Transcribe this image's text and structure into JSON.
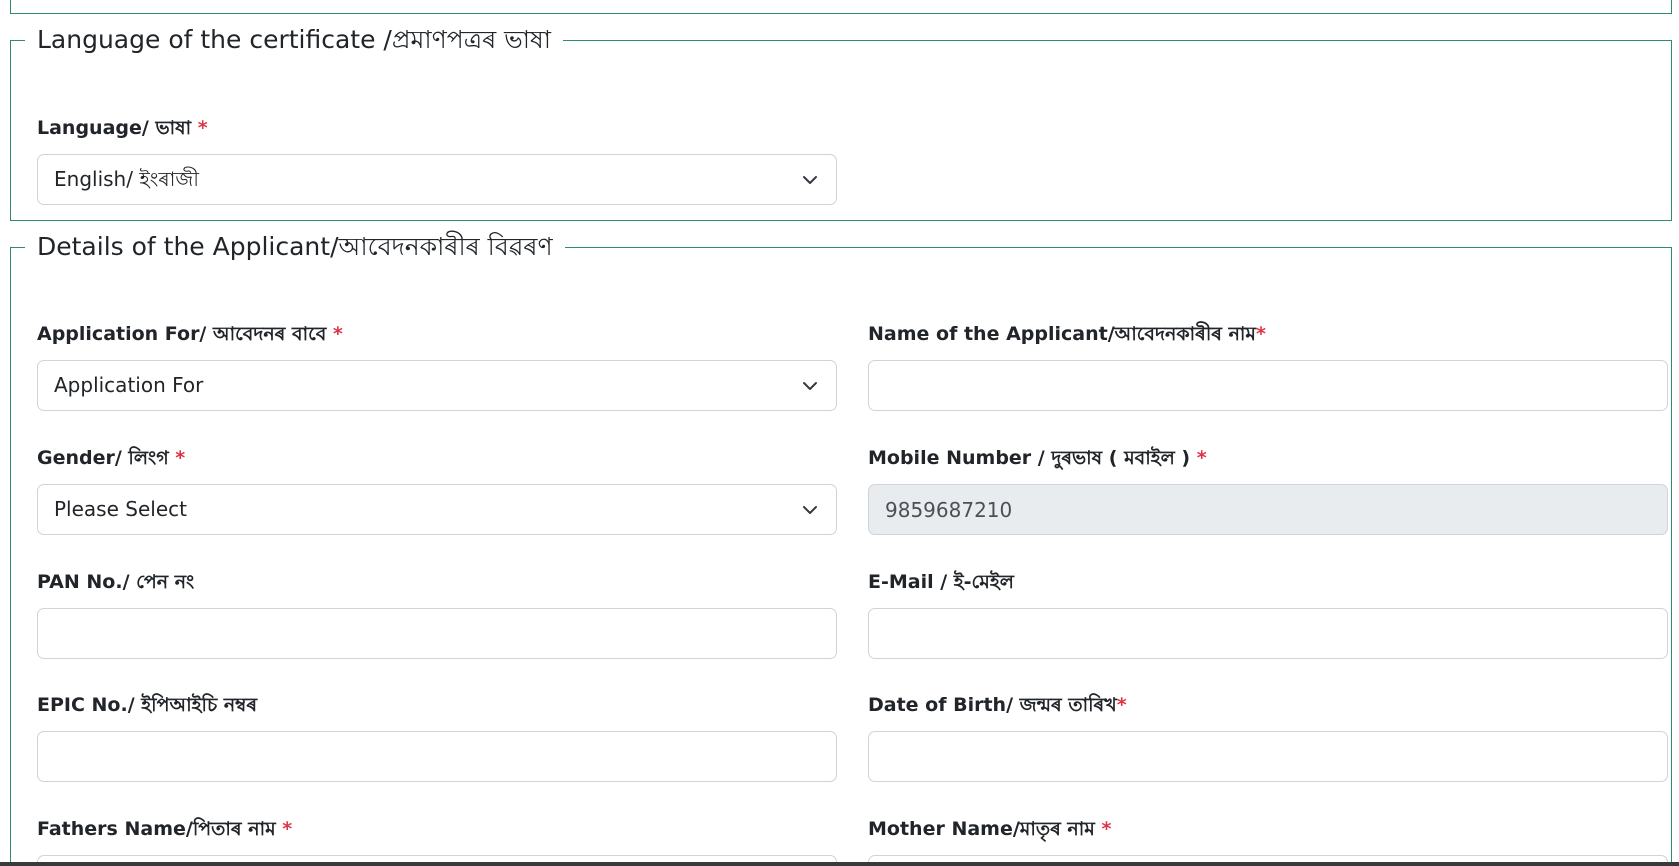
{
  "sections": {
    "language": {
      "legend": "Language of the certificate /প্ৰমাণপত্ৰৰ ভাষা",
      "fields": {
        "language": {
          "label": "Language/ ভাষা",
          "required": "*",
          "value": "English/ ইংৰাজী"
        }
      }
    },
    "details": {
      "legend": "Details of the Applicant/আবেদনকাৰীৰ বিৱৰণ",
      "fields": {
        "application_for": {
          "label": "Application For/ আবেদনৰ বাবে",
          "required": "*",
          "value": "Application For"
        },
        "name": {
          "label": "Name of the Applicant/আবেদনকাৰীৰ নাম",
          "required": "*",
          "value": "",
          "placeholder": ""
        },
        "gender": {
          "label": "Gender/ লিংগ",
          "required": "*",
          "value": "Please Select"
        },
        "mobile": {
          "label": "Mobile Number / দুৰভাষ ( মবাইল )",
          "required": "*",
          "value": "9859687210"
        },
        "pan": {
          "label": "PAN No./ পেন নং",
          "value": ""
        },
        "email": {
          "label": "E-Mail / ই-মেইল",
          "value": ""
        },
        "epic": {
          "label": "EPIC No./ ইপিআইচি নম্বৰ",
          "value": ""
        },
        "dob": {
          "label": "Date of Birth/ জন্মৰ তাৰিখ",
          "required": "*",
          "value": ""
        },
        "father": {
          "label": "Fathers Name/পিতাৰ নাম",
          "required": "*",
          "value": ""
        },
        "mother": {
          "label": "Mother Name/মাতৃৰ নাম",
          "required": "*",
          "value": ""
        }
      }
    }
  },
  "colors": {
    "border_accent": "#2e8b6e",
    "required": "#dc3545",
    "readonly_bg": "#e9ecef"
  },
  "icons": {
    "select_arrow": "chevron-down-icon"
  }
}
